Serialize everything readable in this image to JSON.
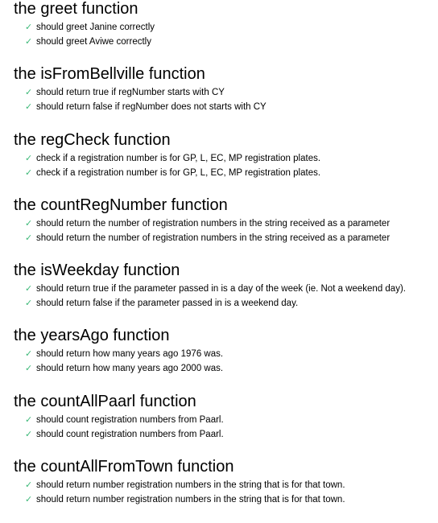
{
  "passed_mark": "✓",
  "colors": {
    "pass": "#3cb878",
    "text": "#000000",
    "background": "#ffffff"
  },
  "suites": [
    {
      "title": "the greet function",
      "tests": [
        "should greet Janine correctly",
        "should greet Aviwe correctly"
      ]
    },
    {
      "title": "the isFromBellville function",
      "tests": [
        "should return true if regNumber starts with CY",
        "should return false if regNumber does not starts with CY"
      ]
    },
    {
      "title": "the regCheck function",
      "tests": [
        "check if a registration number is for GP, L, EC, MP registration plates.",
        "check if a registration number is for GP, L, EC, MP registration plates."
      ]
    },
    {
      "title": "the countRegNumber function",
      "tests": [
        "should return the number of registration numbers in the string received as a parameter",
        "should return the number of registration numbers in the string received as a parameter"
      ]
    },
    {
      "title": "the isWeekday function",
      "tests": [
        "should return true if the parameter passed in is a day of the week (ie. Not a weekend day).",
        "should return false if the parameter passed in is a weekend day."
      ]
    },
    {
      "title": "the yearsAgo function",
      "tests": [
        "should return how many years ago 1976 was.",
        "should return how many years ago 2000 was."
      ]
    },
    {
      "title": "the countAllPaarl function",
      "tests": [
        "should count registration numbers from Paarl.",
        "should count registration numbers from Paarl."
      ]
    },
    {
      "title": "the countAllFromTown function",
      "tests": [
        "should return number registration numbers in the string that is for that town.",
        "should return number registration numbers in the string that is for that town."
      ]
    }
  ]
}
